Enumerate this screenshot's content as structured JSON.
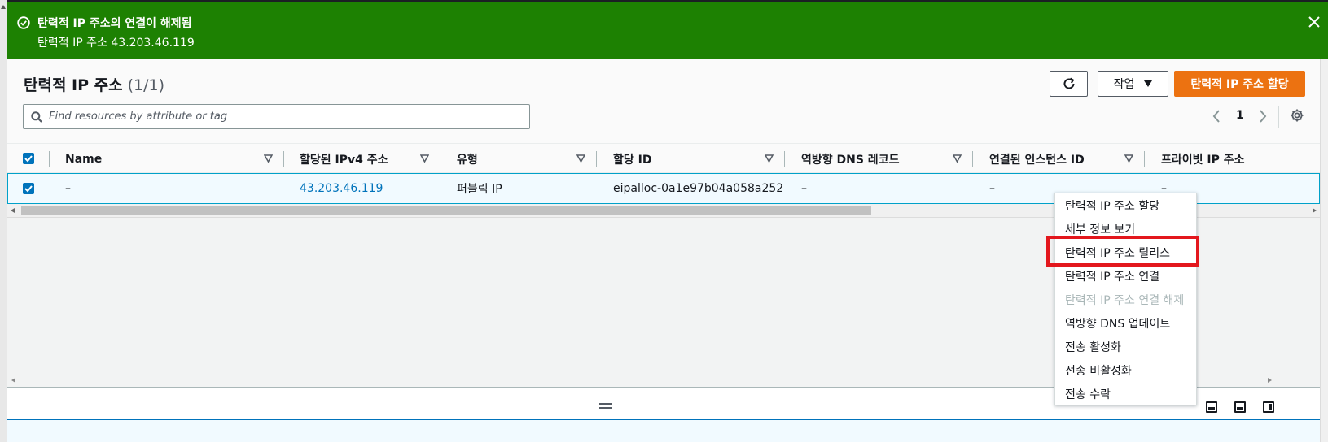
{
  "flash": {
    "title": "탄력적 IP 주소의 연결이 해제됨",
    "message": "탄력적 IP 주소 43.203.46.119",
    "color": "#1d8102"
  },
  "header": {
    "title": "탄력적 IP 주소",
    "count": "(1/1)",
    "actions_label": "작업",
    "primary_label": "탄력적 IP 주소 할당"
  },
  "search": {
    "placeholder": "Find resources by attribute or tag"
  },
  "pagination": {
    "current_page": "1"
  },
  "table": {
    "columns": [
      "Name",
      "할당된 IPv4 주소",
      "유형",
      "할당 ID",
      "역방향 DNS 레코드",
      "연결된 인스턴스 ID",
      "프라이빗 IP 주소"
    ],
    "rows": [
      {
        "name": "–",
        "ipv4": "43.203.46.119",
        "type": "퍼블릭 IP",
        "allocation_id": "eipalloc-0a1e97b04a058a252",
        "reverse_dns": "–",
        "instance_id": "–",
        "private_ip": "–"
      }
    ]
  },
  "actions_menu": {
    "items": [
      {
        "label": "탄력적 IP 주소 할당",
        "disabled": false
      },
      {
        "label": "세부 정보 보기",
        "disabled": false
      },
      {
        "label": "탄력적 IP 주소 릴리스",
        "disabled": false
      },
      {
        "label": "탄력적 IP 주소 연결",
        "disabled": false
      },
      {
        "label": "탄력적 IP 주소 연결 해제",
        "disabled": true
      },
      {
        "label": "역방향 DNS 업데이트",
        "disabled": false
      },
      {
        "label": "전송 활성화",
        "disabled": false
      },
      {
        "label": "전송 비활성화",
        "disabled": false
      },
      {
        "label": "전송 수락",
        "disabled": false
      }
    ]
  },
  "colors": {
    "primary": "#ec7211",
    "link": "#0073bb",
    "highlight": "#e3171d"
  }
}
